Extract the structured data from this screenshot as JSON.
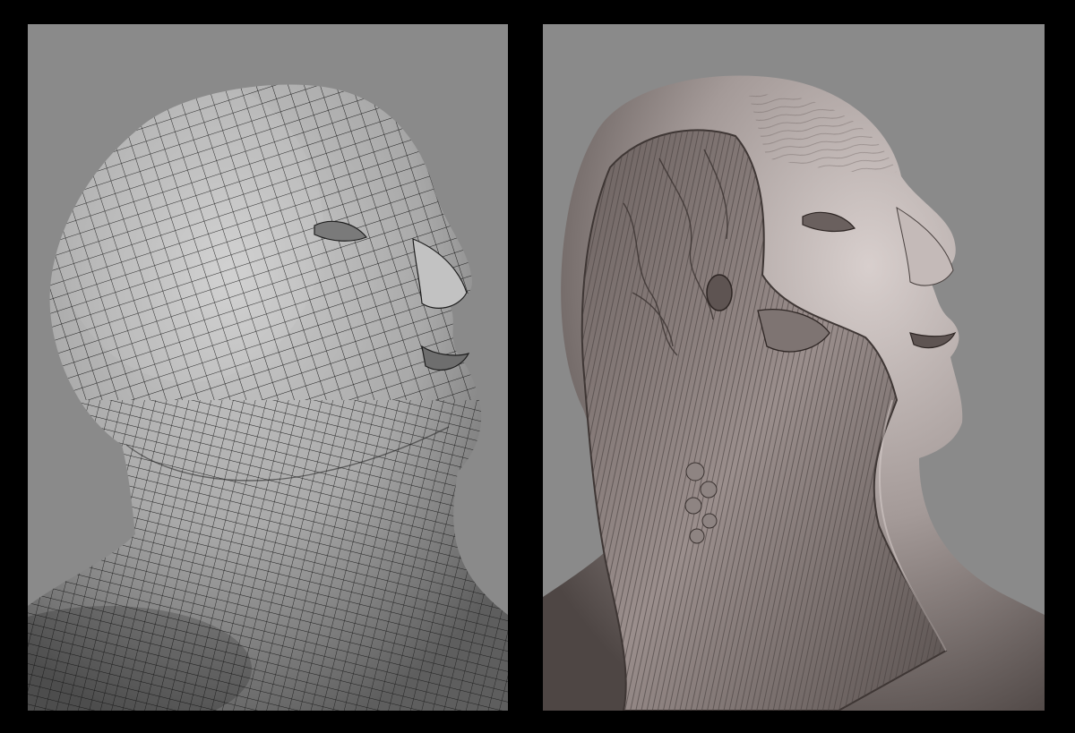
{
  "colors": {
    "frame": "#000000",
    "viewport_background": "#8a8a8a",
    "wireframe_skin": "#b4b4b4",
    "wireframe_lines": "#1e1e1e",
    "sculpt_skin": "#a49a98",
    "sculpt_muscle": "#8a7e7c"
  },
  "panels": [
    {
      "name": "wireframe-topology-render",
      "content": "head-and-neck-mesh-icon"
    },
    {
      "name": "sculpted-anatomy-render",
      "content": "head-and-neck-sculpt-icon"
    }
  ]
}
